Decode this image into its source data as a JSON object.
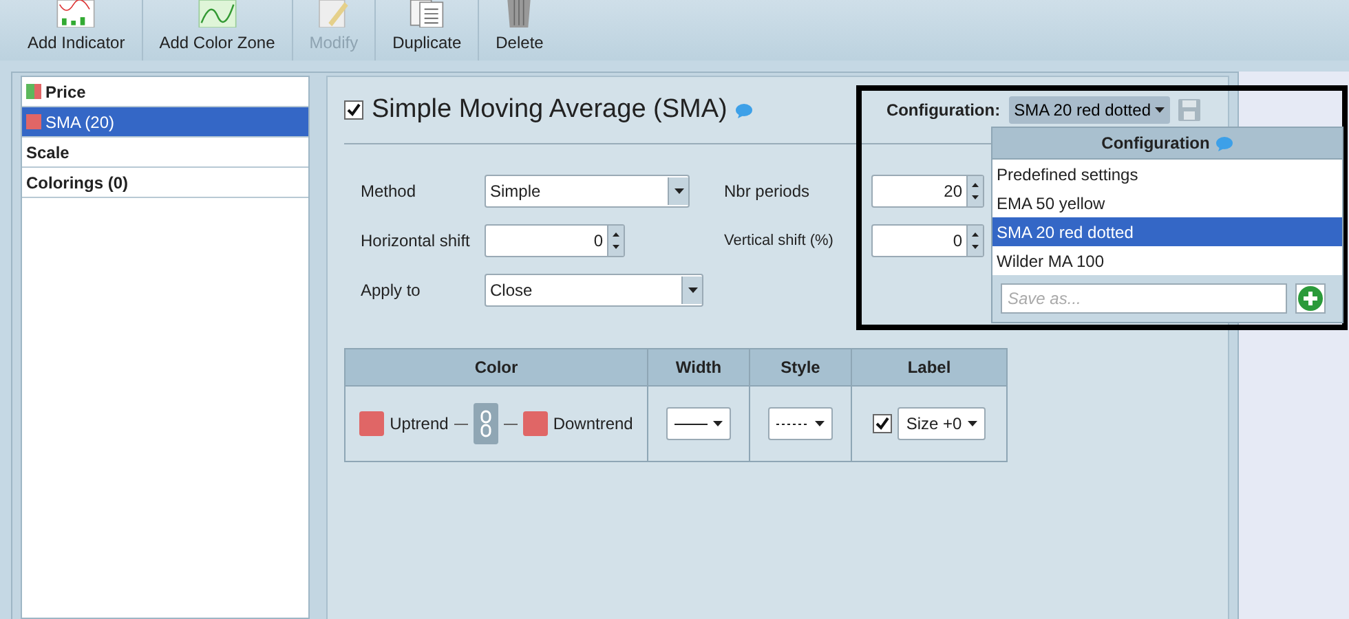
{
  "toolbar": [
    {
      "label": "Add Indicator",
      "kind": "indicator",
      "disabled": false
    },
    {
      "label": "Add Color Zone",
      "kind": "zone",
      "disabled": false
    },
    {
      "label": "Modify",
      "kind": "modify",
      "disabled": true
    },
    {
      "label": "Duplicate",
      "kind": "duplicate",
      "disabled": false
    },
    {
      "label": "Delete",
      "kind": "delete",
      "disabled": false
    }
  ],
  "sidebar": {
    "items": [
      {
        "label": "Price",
        "kind": "series",
        "swatches": [
          {
            "color": "#5cb85c"
          },
          {
            "color": "#e06666"
          }
        ],
        "selected": false
      },
      {
        "label": "SMA (20)",
        "kind": "series",
        "swatches": [
          {
            "color": "#e06666"
          }
        ],
        "selected": true
      },
      {
        "label": "Scale",
        "kind": "section",
        "selected": false
      },
      {
        "label": "Colorings (0)",
        "kind": "section",
        "selected": false
      }
    ]
  },
  "indicator": {
    "title": "Simple Moving Average (SMA)",
    "enabled": true
  },
  "configuration": {
    "label": "Configuration:",
    "value": "SMA 20 red dotted"
  },
  "config_menu": {
    "title": "Configuration",
    "options": [
      {
        "label": "Predefined settings",
        "selected": false
      },
      {
        "label": "EMA 50 yellow",
        "selected": false
      },
      {
        "label": "SMA 20 red dotted",
        "selected": true
      },
      {
        "label": "Wilder MA 100",
        "selected": false
      }
    ],
    "placeholder": "Save as..."
  },
  "fields": [
    {
      "label": "Method",
      "kind": "select",
      "value": "Simple"
    },
    {
      "label": "Nbr periods",
      "kind": "spinner",
      "value": "20"
    },
    {
      "label": "Horizontal shift",
      "kind": "spinner",
      "value": "0"
    },
    {
      "label": "Vertical shift (%)",
      "kind": "spinner",
      "value": "0"
    },
    {
      "label": "Apply to",
      "kind": "select",
      "value": "Close"
    }
  ],
  "style_table": {
    "columns": [
      "Color",
      "Width",
      "Style",
      "Label"
    ],
    "uptrend": {
      "label": "Uptrend",
      "color": "#e06666"
    },
    "downtrend": {
      "label": "Downtrend",
      "color": "#e06666"
    },
    "linked": true,
    "width": {
      "kind": "solid"
    },
    "style": {
      "kind": "dotted"
    },
    "label_checked": true,
    "label_size": "Size +0"
  }
}
